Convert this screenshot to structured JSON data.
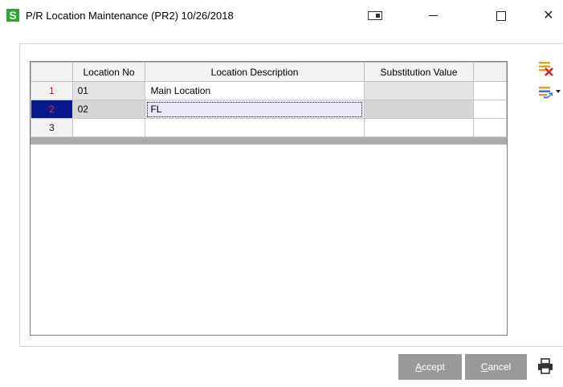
{
  "window": {
    "app_logo": "S",
    "title": "P/R Location Maintenance (PR2) 10/26/2018",
    "minimize_glyph": "—",
    "maximize_glyph": "☐",
    "close_glyph": "✕"
  },
  "grid": {
    "columns": [
      "",
      "Location No",
      "Location Description",
      "Substitution Value",
      ""
    ],
    "rows": [
      {
        "num": "1",
        "location_no": "01",
        "description": "Main Location",
        "substitution": ""
      },
      {
        "num": "2",
        "location_no": "02",
        "description": "FL",
        "substitution": ""
      },
      {
        "num": "3",
        "location_no": "",
        "description": "",
        "substitution": ""
      }
    ]
  },
  "toolbar": {
    "delete_icon": "delete-row-icon",
    "insert_icon": "insert-row-icon"
  },
  "buttons": {
    "accept_key": "A",
    "accept_rest": "ccept",
    "cancel_key": "C",
    "cancel_rest": "ancel"
  },
  "colors": {
    "logo_green": "#2ea635",
    "selected_row_marker": "#0a1a8c",
    "row_number_red": "#e0101a",
    "button_gray": "#9a9a9a"
  }
}
